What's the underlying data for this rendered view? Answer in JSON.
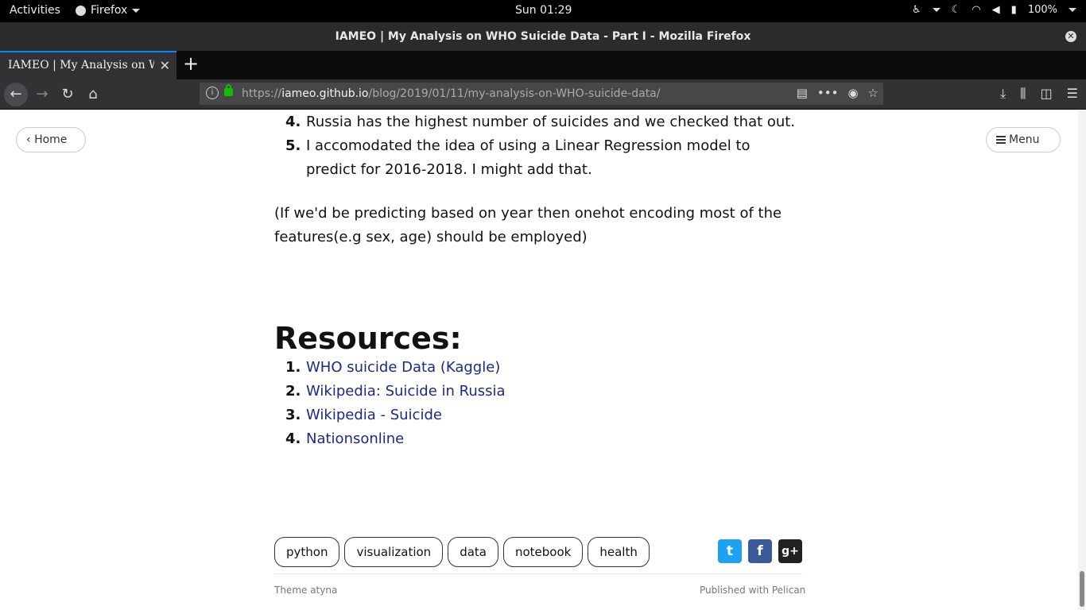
{
  "system": {
    "activities": "Activities",
    "app_name": "Firefox",
    "clock": "Sun 01:29",
    "battery": "100%"
  },
  "window": {
    "title": "IAMEO | My Analysis on WHO Suicide Data - Part I - Mozilla Firefox"
  },
  "tabs": [
    {
      "label": "IAMEO | My Analysis on WHO Suicide Data - Part I"
    }
  ],
  "urlbar": {
    "scheme": "https://",
    "host": "iameo.github.io",
    "path": "/blog/2019/01/11/my-analysis-on-WHO-suicide-data/"
  },
  "page": {
    "home_label": "Home",
    "menu_label": "Menu",
    "list_items": [
      {
        "num": "4.",
        "text": "Russia has the highest number of suicides and we checked that out."
      },
      {
        "num": "5.",
        "text": "I accomodated the idea of using a Linear Regression model to predict for 2016-2018. I might add that."
      }
    ],
    "paragraph": "(If we'd be predicting based on year then onehot encoding most of the features(e.g sex, age) should be employed)",
    "resources_heading": "Resources:",
    "resources": [
      {
        "num": "1.",
        "text": "WHO suicide Data (Kaggle)"
      },
      {
        "num": "2.",
        "text": "Wikipedia: Suicide in Russia"
      },
      {
        "num": "3.",
        "text": "Wikipedia - Suicide"
      },
      {
        "num": "4.",
        "text": "Nationsonline"
      }
    ],
    "tags": [
      "python",
      "visualization",
      "data",
      "notebook",
      "health"
    ],
    "footer_left": "Theme atyna",
    "footer_right": "Published with Pelican"
  },
  "colors": {
    "link": "#1c2a80",
    "twitter": "#1da1f2",
    "facebook": "#3b5998",
    "accent": "#0a84ff"
  }
}
